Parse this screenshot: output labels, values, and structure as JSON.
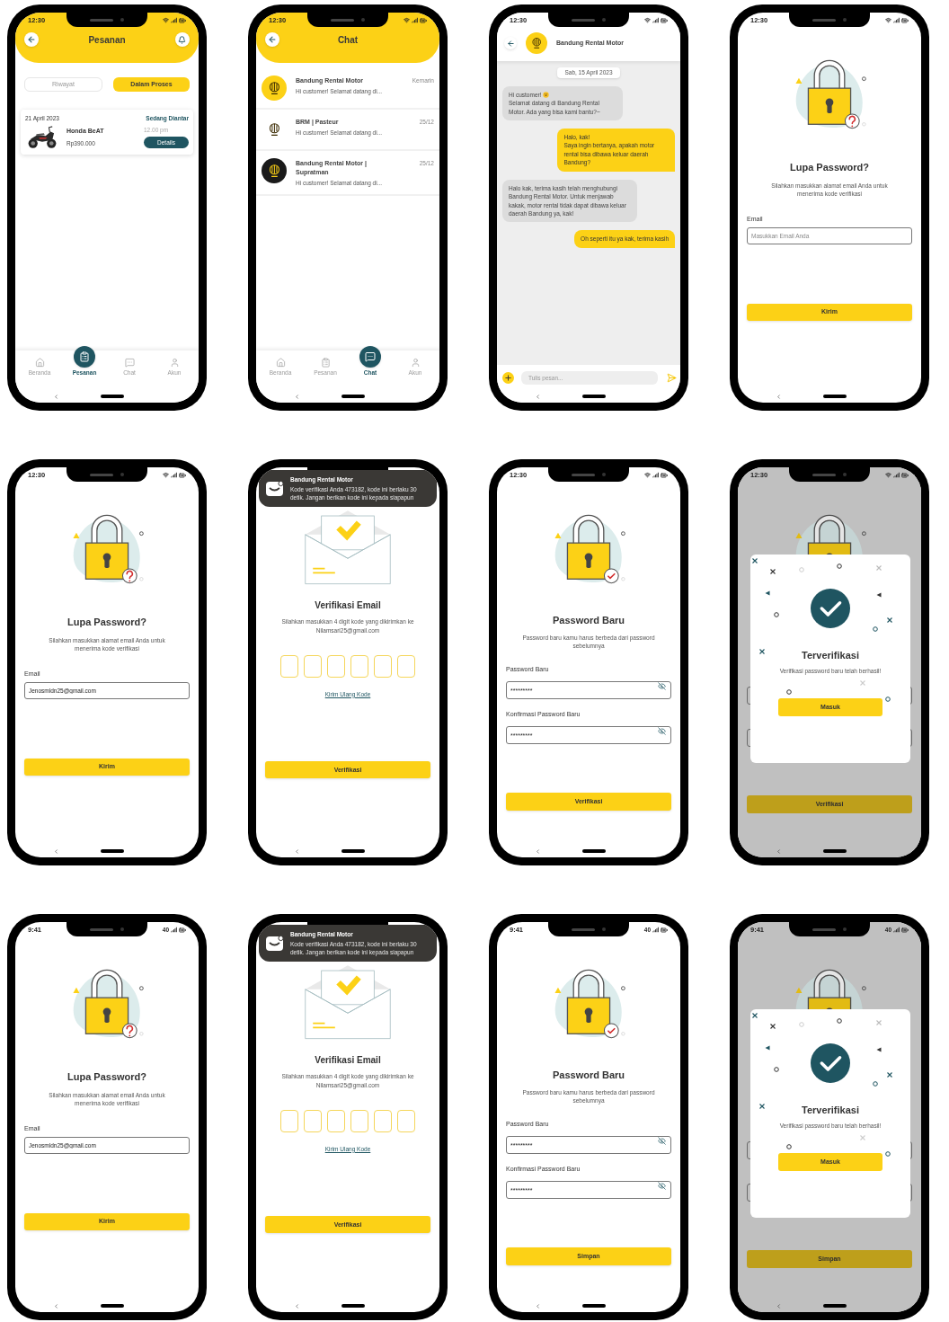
{
  "phones": [
    {
      "kind": "orders",
      "status_bar": {
        "time": "12:30"
      },
      "title": "Pesanan",
      "tabs": [
        {
          "label": "Riwayat",
          "selected": false
        },
        {
          "label": "Dalam Proses",
          "selected": true
        }
      ],
      "order": {
        "date": "21 April 2023",
        "status": "Sedang Diantar",
        "name": "Honda BeAT",
        "price": "Rp390.000",
        "time": "12.00 pm",
        "button": "Details"
      },
      "nav": [
        {
          "kind": "home",
          "label": "Beranda",
          "selected": false
        },
        {
          "kind": "orders",
          "label": "Pesanan",
          "selected": true
        },
        {
          "kind": "chat",
          "label": "Chat",
          "selected": false
        },
        {
          "kind": "account",
          "label": "Akun",
          "selected": false
        }
      ]
    },
    {
      "kind": "chat_list",
      "status_bar": {
        "time": "12:30"
      },
      "title": "Chat",
      "chats": [
        {
          "name": "Bandung Rental Motor",
          "preview": "Hi customer! Selamat datang di...",
          "time": "Kemarin",
          "color": "#fcd116"
        },
        {
          "name": "BRM | Pasteur",
          "preview": "Hi customer! Selamat datang di...",
          "time": "25/12",
          "color": "#ffffff"
        },
        {
          "name": "Bandung Rental Motor | Supratman",
          "preview": "Hi customer! Selamat datang di...",
          "time": "25/12",
          "color": "#1a1a1a"
        }
      ],
      "nav": [
        {
          "kind": "home",
          "label": "Beranda",
          "selected": false
        },
        {
          "kind": "orders",
          "label": "Pesanan",
          "selected": false
        },
        {
          "kind": "chat",
          "label": "Chat",
          "selected": true
        },
        {
          "kind": "account",
          "label": "Akun",
          "selected": false
        }
      ]
    },
    {
      "kind": "chat",
      "status_bar": {
        "time": "12:30"
      },
      "contact": "Bandung Rental Motor",
      "date": "Sab, 15 April 2023",
      "messages": [
        {
          "kind": "received",
          "lead": "Hi customer!",
          "emoji": true,
          "text": "Selamat datang di Bandung Rental Motor. Ada yang bisa kami bantu?~"
        },
        {
          "kind": "sent",
          "text": "Halo, kak!\nSaya ingin bertanya, apakah motor rental bisa dibawa keluar daerah Bandung?"
        },
        {
          "kind": "received",
          "text": "Halo kak, terima kasih telah menghubungi Bandung Rental Motor. Untuk menjawab kakak, motor rental tidak dapat dibawa keluar daerah Bandung ya, kak!"
        },
        {
          "kind": "sent",
          "text": "Oh seperti itu ya kak, terima kasih"
        }
      ],
      "input": {
        "placeholder": "Tulis pesan..."
      }
    },
    {
      "kind": "forgot",
      "status_bar": {
        "time": "12:30"
      },
      "lock": {
        "kind": "question"
      },
      "title": "Lupa Password?",
      "description": "Silahkan masukkan alamat email Anda untuk menerima kode verifikasi",
      "field": {
        "label": "Email",
        "placeholder": "Masukkan Email Anda"
      },
      "button": "Kirim"
    },
    {
      "kind": "forgot",
      "status_bar": {
        "time": "12:30"
      },
      "lock": {
        "kind": "question"
      },
      "title": "Lupa Password?",
      "description": "Silahkan masukkan alamat email Anda untuk menerima kode verifikasi",
      "field": {
        "label": "Email",
        "value": "Jenosmldn25@gmail.com"
      },
      "button": "Kirim"
    },
    {
      "kind": "verify_email",
      "notification": {
        "app": "Bandung Rental Motor",
        "text": "Kode verifikasi Anda 473182, kode ini berlaku 30 detik. Jangan berikan kode ini kepada siapapun"
      },
      "title": "Verifikasi Email",
      "description": "Silahkan masukkan 4 digit kode yang dikirimkan ke Nilamsari25@gmail.com",
      "resend": "Kirim Ulang Kode",
      "button": "Verifikasi"
    },
    {
      "kind": "new_password",
      "status_bar": {
        "time": "12:30"
      },
      "lock": {
        "kind": "check"
      },
      "title": "Password Baru",
      "description": "Password baru kamu harus berbeda dari password sebelumnya",
      "fields": [
        {
          "label": "Password Baru",
          "value": "*********"
        },
        {
          "label": "Konfirmasi Password Baru",
          "value": "*********"
        }
      ],
      "button": "Verifikasi"
    },
    {
      "kind": "success",
      "status_bar": {
        "time": "12:30"
      },
      "lock": {
        "kind": "check"
      },
      "button": "Verifikasi",
      "dialog": {
        "title": "Terverifikasi",
        "message": "Verifikasi password baru telah berhasil!",
        "button": "Masuk"
      }
    },
    {
      "kind": "forgot",
      "status_bar": {
        "time": "9:41",
        "network": "40"
      },
      "lock": {
        "kind": "question"
      },
      "title": "Lupa Password?",
      "description": "Silahkan masukkan alamat email Anda untuk menerima kode verifikasi",
      "field": {
        "label": "Email",
        "value": "Jenosmldn25@gmail.com"
      },
      "button": "Kirim"
    },
    {
      "kind": "verify_email",
      "notification": {
        "app": "Bandung Rental Motor",
        "text": "Kode verifikasi Anda 473182, kode ini berlaku 30 detik. Jangan berikan kode ini kepada siapapun"
      },
      "title": "Verifikasi Email",
      "description": "Silahkan masukkan 4 digit kode yang dikirimkan ke Nilamsari25@gmail.com",
      "resend": "Kirim Ulang Kode",
      "button": "Verifikasi"
    },
    {
      "kind": "new_password",
      "status_bar": {
        "time": "9:41",
        "network": "40"
      },
      "lock": {
        "kind": "check"
      },
      "title": "Password Baru",
      "description": "Password baru kamu harus berbeda dari password sebelumnya",
      "fields": [
        {
          "label": "Password Baru",
          "value": "*********"
        },
        {
          "label": "Konfirmasi Password Baru",
          "value": "*********"
        }
      ],
      "button": "Simpan"
    },
    {
      "kind": "success",
      "status_bar": {
        "time": "9:41",
        "network": "40"
      },
      "lock": {
        "kind": "check"
      },
      "button": "Simpan",
      "dialog": {
        "title": "Terverifikasi",
        "message": "Verifikasi password baru telah berhasil!",
        "button": "Masuk"
      }
    }
  ]
}
